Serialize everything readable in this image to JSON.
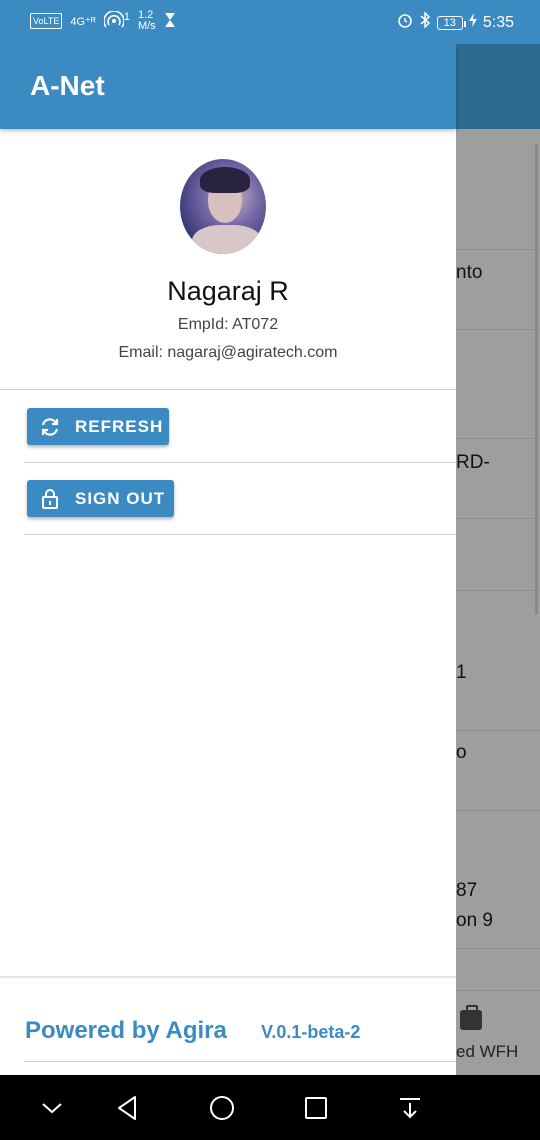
{
  "status_bar": {
    "volte": "VoLTE",
    "network": "4G⁺ᴿ",
    "hotspot_count": "1",
    "speed_value": "1.2",
    "speed_unit": "M/s",
    "battery": "13",
    "time": "5:35"
  },
  "app": {
    "title": "A-Net"
  },
  "profile": {
    "name": "Nagaraj R",
    "emp_id": "EmpId: AT072",
    "email": "Email: nagaraj@agiratech.com"
  },
  "actions": {
    "refresh_label": "REFRESH",
    "signout_label": "SIGN OUT"
  },
  "footer": {
    "powered_by": "Powered by Agira",
    "version": "V.0.1-beta-2"
  },
  "background_list": {
    "fragments": [
      "nto",
      "RD-",
      "1",
      "o",
      "87",
      "on 9",
      "ed WFH"
    ]
  },
  "colors": {
    "primary": "#3b8bc2",
    "header_dim": "#2d6b93",
    "scrim": "#9e9e9e"
  },
  "icons": {
    "refresh": "refresh-icon",
    "signout": "lock-icon",
    "nav": [
      "chevron-down-icon",
      "back-icon",
      "home-icon",
      "recents-icon",
      "notification-pull-icon"
    ]
  }
}
